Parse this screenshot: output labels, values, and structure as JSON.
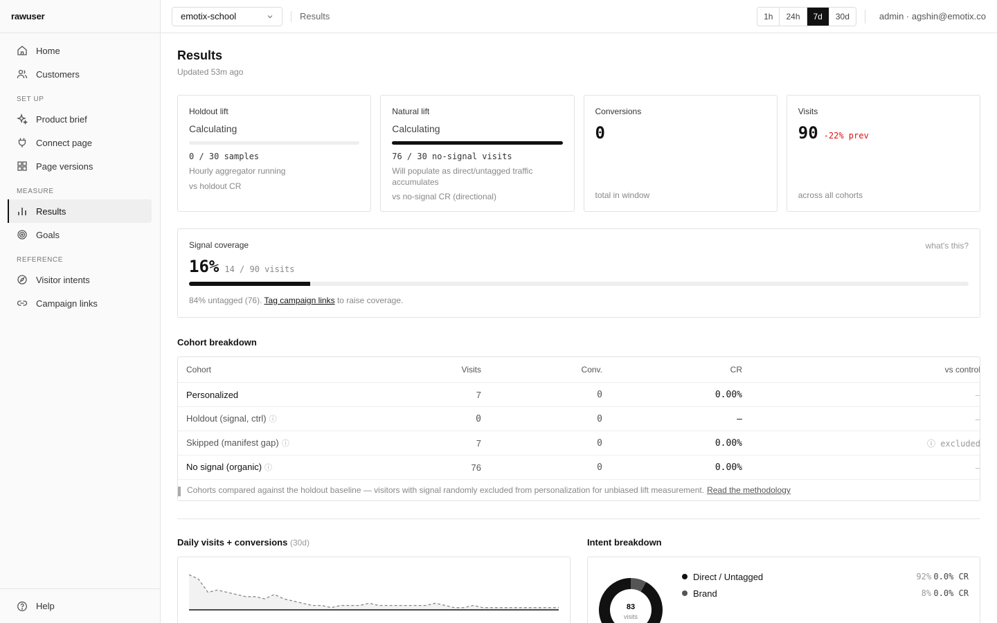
{
  "app": {
    "name": "rawuser"
  },
  "sidebar": {
    "items_top": [
      {
        "label": "Home"
      },
      {
        "label": "Customers"
      }
    ],
    "setup_label": "SET UP",
    "setup_items": [
      {
        "label": "Product brief"
      },
      {
        "label": "Connect page"
      },
      {
        "label": "Page versions"
      }
    ],
    "measure_label": "MEASURE",
    "measure_items": [
      {
        "label": "Results"
      },
      {
        "label": "Goals"
      }
    ],
    "reference_label": "REFERENCE",
    "reference_items": [
      {
        "label": "Visitor intents"
      },
      {
        "label": "Campaign links"
      }
    ],
    "help_label": "Help"
  },
  "topbar": {
    "project": "emotix-school",
    "breadcrumb": "Results",
    "ranges": [
      "1h",
      "24h",
      "7d",
      "30d"
    ],
    "selected_range": "7d",
    "user": "admin · agshin@emotix.co"
  },
  "page": {
    "title": "Results",
    "updated": "Updated 53m ago"
  },
  "cards": {
    "holdout": {
      "label": "Holdout lift",
      "status": "Calculating",
      "progress": 0,
      "samples": "0 / 30 samples",
      "note": "Hourly aggregator running",
      "foot": "vs holdout CR"
    },
    "natural": {
      "label": "Natural lift",
      "status": "Calculating",
      "progress": 1.0,
      "samples": "76 / 30 no-signal visits",
      "note": "Will populate as direct/untagged traffic accumulates",
      "foot": "vs no-signal CR (directional)"
    },
    "conversions": {
      "label": "Conversions",
      "value": "0",
      "foot": "total in window"
    },
    "visits": {
      "label": "Visits",
      "value": "90",
      "delta": "-22% prev",
      "foot": "across all cohorts"
    }
  },
  "coverage": {
    "label": "Signal coverage",
    "help": "what's this?",
    "percent": "16%",
    "fraction": "14 / 90 visits",
    "fill": 0.155,
    "note_pre": "84% untagged (76).",
    "note_link": "Tag campaign links",
    "note_post": "to raise coverage."
  },
  "cohorts": {
    "title": "Cohort breakdown",
    "headers": [
      "Cohort",
      "Visits",
      "Conv.",
      "CR",
      "vs control"
    ],
    "rows": [
      {
        "name": "Personalized",
        "visits": "7",
        "conv": "0",
        "cr": "0.00%",
        "vs": "–"
      },
      {
        "name": "Holdout (signal, ctrl)",
        "visits": "0",
        "conv": "0",
        "cr": "—",
        "vs": "–"
      },
      {
        "name": "Skipped (manifest gap)",
        "visits": "7",
        "conv": "0",
        "cr": "0.00%",
        "vs": "ⓘ excluded"
      },
      {
        "name": "No signal (organic)",
        "visits": "76",
        "conv": "0",
        "cr": "0.00%",
        "vs": "–"
      }
    ],
    "note": "Cohorts compared against the holdout baseline — visitors with signal randomly excluded from personalization for unbiased lift measurement.",
    "note_link": "Read the methodology"
  },
  "daily": {
    "title": "Daily visits + conversions",
    "period": "(30d)"
  },
  "chart_data": {
    "type": "line",
    "title": "Daily visits + conversions",
    "series": [
      {
        "values": [
          16,
          14,
          8,
          9,
          8,
          7,
          6,
          6,
          5,
          7,
          5,
          4,
          3,
          2,
          2,
          1,
          2,
          2,
          2,
          3,
          2,
          2,
          2,
          2,
          2,
          2,
          3,
          2,
          1,
          1,
          2,
          1,
          1,
          1,
          1,
          1,
          1,
          1,
          1,
          1
        ]
      },
      {
        "values": [
          0,
          0,
          0,
          0,
          0,
          0,
          0,
          0,
          0,
          0,
          0,
          0,
          0,
          0,
          0,
          0,
          0,
          0,
          0,
          0,
          0,
          0,
          0,
          0,
          0,
          0,
          0,
          0,
          0,
          0,
          0,
          0,
          0,
          0,
          0,
          0,
          0,
          0,
          0,
          0
        ]
      }
    ],
    "ylim": [
      0,
      17
    ]
  },
  "intent": {
    "title": "Intent breakdown",
    "center_value": "83",
    "center_label": "visits",
    "items": [
      {
        "label": "Direct / Untagged",
        "share": "92%",
        "cr": "0.0% CR",
        "color": "#111111",
        "fraction": 0.92
      },
      {
        "label": "Brand",
        "share": "8%",
        "cr": "0.0% CR",
        "color": "#555555",
        "fraction": 0.08
      }
    ]
  }
}
